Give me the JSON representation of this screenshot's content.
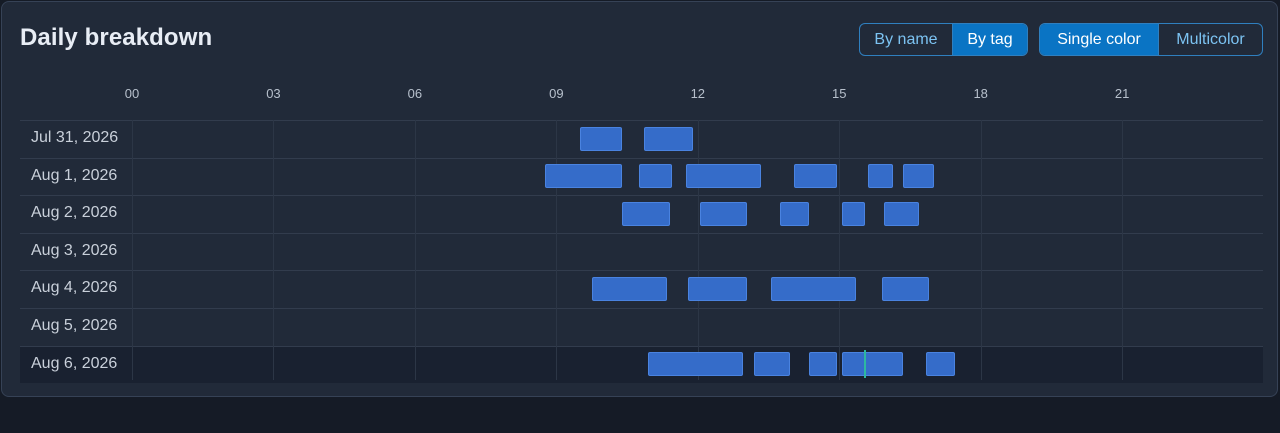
{
  "header": {
    "title": "Daily breakdown"
  },
  "grouping_toggle": {
    "options": [
      "By name",
      "By tag"
    ],
    "active": 1
  },
  "color_toggle": {
    "options": [
      "Single color",
      "Multicolor"
    ],
    "active": 0
  },
  "colors": {
    "bar": "#356cc9",
    "active_toggle": "#0a74c4",
    "now_marker": "#2db8a0"
  },
  "time_axis": {
    "range_hours": [
      0,
      24
    ],
    "ticks": [
      "00",
      "03",
      "06",
      "09",
      "12",
      "15",
      "18",
      "21"
    ]
  },
  "days": [
    {
      "label": "Jul 31, 2026",
      "sessions": [
        [
          9.5,
          10.4
        ],
        [
          10.85,
          11.9
        ]
      ]
    },
    {
      "label": "Aug 1, 2026",
      "sessions": [
        [
          8.75,
          10.4
        ],
        [
          10.75,
          11.45
        ],
        [
          11.75,
          13.35
        ],
        [
          14.05,
          14.95
        ],
        [
          15.6,
          16.15
        ],
        [
          16.35,
          17.0
        ]
      ]
    },
    {
      "label": "Aug 2, 2026",
      "sessions": [
        [
          10.4,
          11.4
        ],
        [
          12.05,
          13.05
        ],
        [
          13.75,
          14.35
        ],
        [
          15.05,
          15.55
        ],
        [
          15.95,
          16.7
        ]
      ]
    },
    {
      "label": "Aug 3, 2026",
      "sessions": []
    },
    {
      "label": "Aug 4, 2026",
      "sessions": [
        [
          9.75,
          11.35
        ],
        [
          11.8,
          13.05
        ],
        [
          13.55,
          15.35
        ],
        [
          15.9,
          16.9
        ]
      ]
    },
    {
      "label": "Aug 5, 2026",
      "sessions": []
    },
    {
      "label": "Aug 6, 2026",
      "sessions": [
        [
          10.95,
          12.95
        ],
        [
          13.2,
          13.95
        ],
        [
          14.35,
          14.95
        ],
        [
          15.05,
          16.35
        ],
        [
          16.85,
          17.45
        ]
      ],
      "now_hour": 15.55
    }
  ]
}
